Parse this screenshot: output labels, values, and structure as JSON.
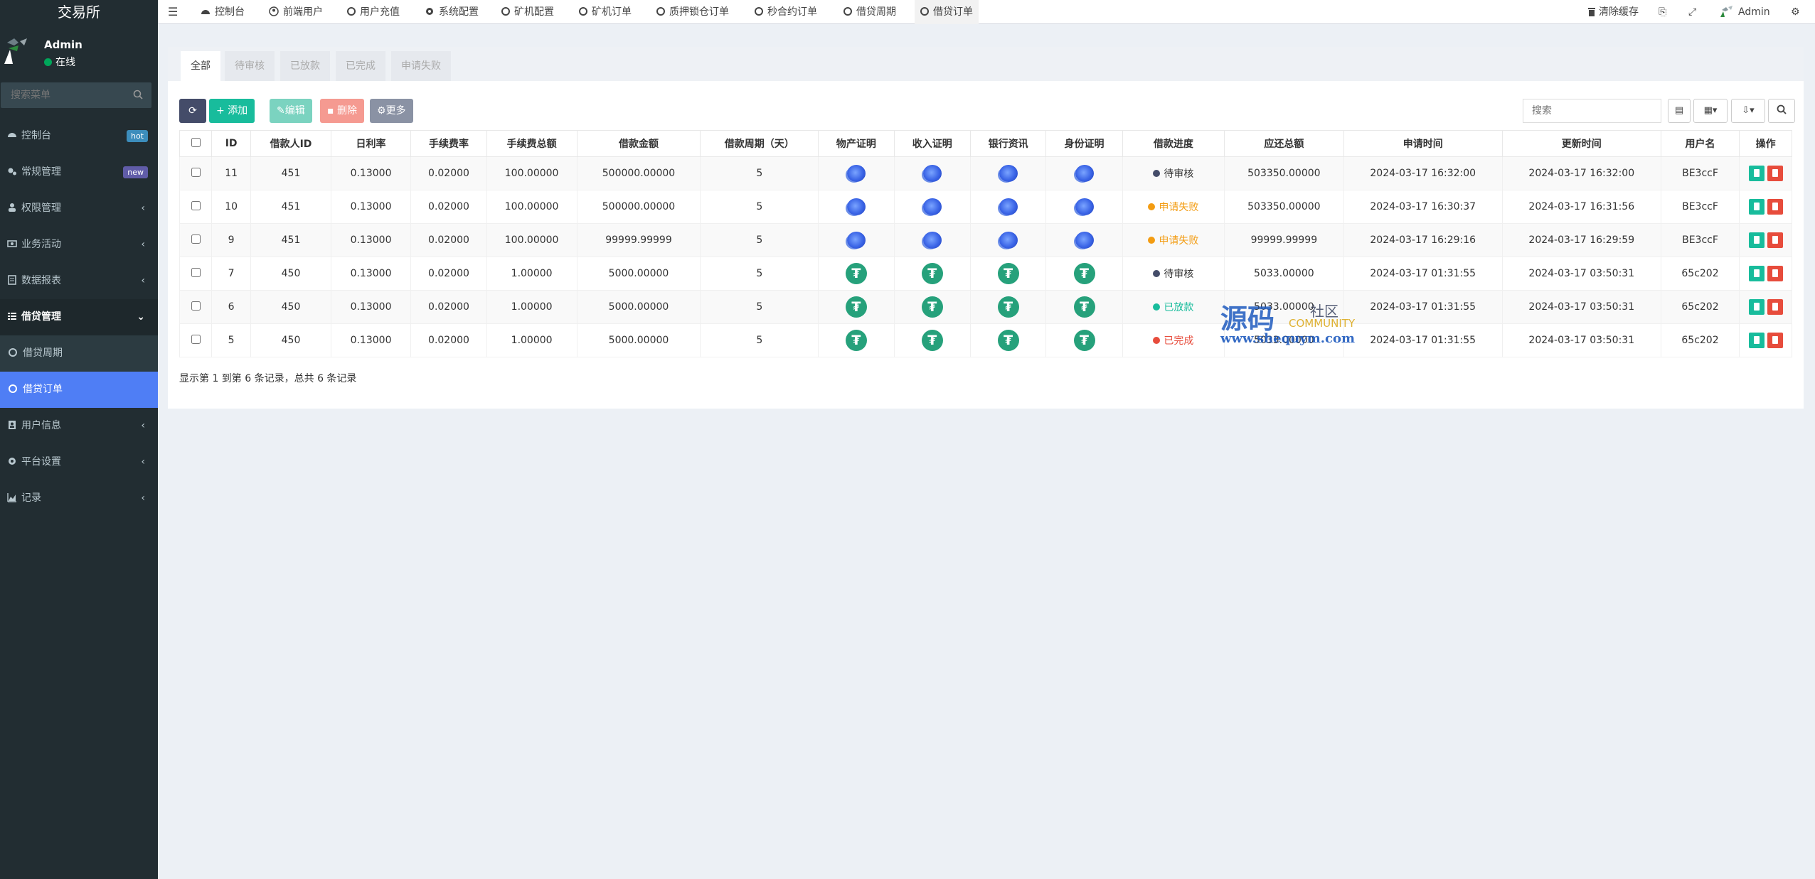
{
  "sidebar": {
    "logo": "交易所",
    "user": {
      "name": "Admin",
      "status": "在线"
    },
    "search_placeholder": "搜索菜单",
    "menu": [
      {
        "label": "控制台",
        "badge": "hot",
        "badge_color": "#3c8dbc"
      },
      {
        "label": "常规管理",
        "badge": "new",
        "badge_color": "#605ca8"
      },
      {
        "label": "权限管理"
      },
      {
        "label": "业务活动"
      },
      {
        "label": "数据报表"
      },
      {
        "label": "借贷管理"
      },
      {
        "label": "借贷周期"
      },
      {
        "label": "借贷订单"
      },
      {
        "label": "用户信息"
      },
      {
        "label": "平台设置"
      },
      {
        "label": "记录"
      }
    ]
  },
  "topnav": {
    "tabs": [
      "控制台",
      "前端用户",
      "用户充值",
      "系统配置",
      "矿机配置",
      "矿机订单",
      "质押锁仓订单",
      "秒合约订单",
      "借贷周期",
      "借贷订单"
    ],
    "clear_cache": "清除缓存",
    "admin": "Admin"
  },
  "panel": {
    "tabs": [
      "全部",
      "待审核",
      "已放款",
      "已完成",
      "申请失败"
    ],
    "buttons": {
      "add": "添加",
      "edit": "编辑",
      "delete": "删除",
      "more": "更多"
    },
    "search_placeholder": "搜索",
    "columns": [
      "ID",
      "借款人ID",
      "日利率",
      "手续费率",
      "手续费总额",
      "借款金额",
      "借款周期（天）",
      "物产证明",
      "收入证明",
      "银行资讯",
      "身份证明",
      "借款进度",
      "应还总额",
      "申请时间",
      "更新时间",
      "用户名",
      "操作"
    ],
    "rows": [
      {
        "id": "11",
        "uid": "451",
        "rate": "0.13000",
        "fee_rate": "0.02000",
        "fee_total": "100.00000",
        "amount": "500000.00000",
        "period": "5",
        "proof": "globe",
        "status": "待审核",
        "status_color": "#444c69",
        "total": "503350.00000",
        "apply": "2024-03-17 16:32:00",
        "update": "2024-03-17 16:32:00",
        "user": "BE3ccF"
      },
      {
        "id": "10",
        "uid": "451",
        "rate": "0.13000",
        "fee_rate": "0.02000",
        "fee_total": "100.00000",
        "amount": "500000.00000",
        "period": "5",
        "proof": "globe",
        "status": "申请失败",
        "status_color": "#f39c12",
        "total": "503350.00000",
        "apply": "2024-03-17 16:30:37",
        "update": "2024-03-17 16:31:56",
        "user": "BE3ccF"
      },
      {
        "id": "9",
        "uid": "451",
        "rate": "0.13000",
        "fee_rate": "0.02000",
        "fee_total": "100.00000",
        "amount": "99999.99999",
        "period": "5",
        "proof": "globe",
        "status": "申请失败",
        "status_color": "#f39c12",
        "total": "99999.99999",
        "apply": "2024-03-17 16:29:16",
        "update": "2024-03-17 16:29:59",
        "user": "BE3ccF"
      },
      {
        "id": "7",
        "uid": "450",
        "rate": "0.13000",
        "fee_rate": "0.02000",
        "fee_total": "1.00000",
        "amount": "5000.00000",
        "period": "5",
        "proof": "usdt",
        "status": "待审核",
        "status_color": "#444c69",
        "total": "5033.00000",
        "apply": "2024-03-17 01:31:55",
        "update": "2024-03-17 03:50:31",
        "user": "65c202"
      },
      {
        "id": "6",
        "uid": "450",
        "rate": "0.13000",
        "fee_rate": "0.02000",
        "fee_total": "1.00000",
        "amount": "5000.00000",
        "period": "5",
        "proof": "usdt",
        "status": "已放款",
        "status_color": "#18bc9c",
        "total": "5033.00000",
        "apply": "2024-03-17 01:31:55",
        "update": "2024-03-17 03:50:31",
        "user": "65c202"
      },
      {
        "id": "5",
        "uid": "450",
        "rate": "0.13000",
        "fee_rate": "0.02000",
        "fee_total": "1.00000",
        "amount": "5000.00000",
        "period": "5",
        "proof": "usdt",
        "status": "已完成",
        "status_color": "#e74c3c",
        "total": "5033.00000",
        "apply": "2024-03-17 01:31:55",
        "update": "2024-03-17 03:50:31",
        "user": "65c202"
      }
    ],
    "footer": "显示第 1 到第 6 条记录，总共 6 条记录"
  },
  "watermark": {
    "big": "源码",
    "small": "社区",
    "community": "COMMUNITY",
    "url": "www.shequym.com"
  }
}
